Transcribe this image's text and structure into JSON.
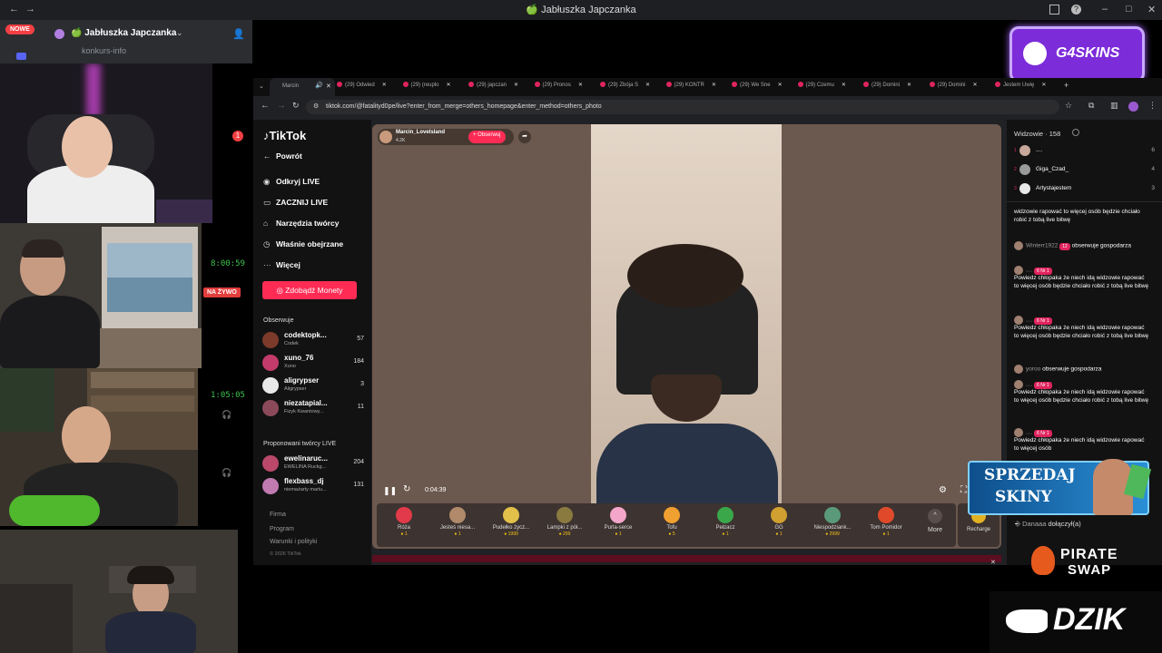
{
  "window": {
    "title": "🍏 Jabłuszka Japczanka"
  },
  "discord": {
    "nowe_badge": "NOWE",
    "server_name": "🍏 Jabłuszka Japczanka",
    "channel": "konkurs-info",
    "mention_count": "1",
    "timer1": "8:00:59",
    "live_badge": "NA ŻYWO",
    "timer2": "1:05:05"
  },
  "browser": {
    "active_tab": "Marcin",
    "tabs": [
      "(29) Odwied",
      "(29) (reuplo",
      "(29) japczan",
      "(29) Pronos",
      "(29) Zbója S",
      "(29) KONTR",
      "(29) We Sne",
      "(29) Czemu",
      "(29) Domini",
      "(29) Domini",
      "Jestem Uwię"
    ],
    "url": "tiktok.com/@fatalityd0pe/live?enter_from_merge=others_homepage&enter_method=others_photo"
  },
  "tiktok": {
    "logo": "TikTok",
    "back": "Powrót",
    "nav": [
      "Odkryj LIVE",
      "ZACZNIJ LIVE",
      "Narzędzia twórcy",
      "Właśnie obejrzane",
      "Więcej"
    ],
    "coins_button": "Zdobądź Monety",
    "following_header": "Obserwuje",
    "following": [
      {
        "name": "codektopk...",
        "sub": "Codek",
        "count": "57"
      },
      {
        "name": "xuno_76",
        "sub": "Xuno",
        "count": "184"
      },
      {
        "name": "aligrypser",
        "sub": "Aligrypser",
        "count": "3"
      },
      {
        "name": "niezatapial...",
        "sub": "Fizyk Kwantowy...",
        "count": "11"
      }
    ],
    "suggested_header": "Proponowani twórcy LIVE",
    "suggested": [
      {
        "name": "ewelinaruc...",
        "sub": "EWELINA Ruckg...",
        "count": "204"
      },
      {
        "name": "flexbass_dj",
        "sub": "niemażarty mariu...",
        "count": "131"
      }
    ],
    "footer": [
      "Firma",
      "Program",
      "Warunki i polityki",
      "© 2026 TikTok"
    ]
  },
  "stream": {
    "host": "Marcin_Lovelsland",
    "likes": "4.2K",
    "follow_button": "+ Obserwuj",
    "time": "0:04:39",
    "gifts": [
      {
        "name": "Róża",
        "price": "1"
      },
      {
        "name": "Jesteś niesa...",
        "price": "1"
      },
      {
        "name": "Pudełko życz...",
        "price": "1999"
      },
      {
        "name": "Lampki z pół...",
        "price": "299"
      },
      {
        "name": "Purla-serce",
        "price": "1"
      },
      {
        "name": "Tofu",
        "price": "5"
      },
      {
        "name": "Pełzacz",
        "price": "1"
      },
      {
        "name": "GG",
        "price": "1"
      },
      {
        "name": "Niespodziank...",
        "price": "2999"
      },
      {
        "name": "Tom Pomidor",
        "price": "1"
      }
    ],
    "more": "More",
    "recharge": "Recharge"
  },
  "viewers_panel": {
    "title": "Widzowie · 158",
    "top": [
      {
        "rank": "1",
        "name": "....",
        "score": "6"
      },
      {
        "rank": "2",
        "name": "Giga_Czad_",
        "score": "4"
      },
      {
        "rank": "3",
        "name": "Artystajestem",
        "score": "3"
      }
    ],
    "comments": [
      {
        "user": "",
        "badge": "",
        "text": "widzowie rapować to więcej osób będzie chciało robić z tobą live bitwę"
      },
      {
        "user": "Winterr1922",
        "badge": "12",
        "text": "obserwuje gospodarza"
      },
      {
        "user": "....",
        "badge": "6 Nr 1",
        "text": "Powiedz chłopaka że niech idą widzowie rapować to więcej osób będzie chciało robić z tobą live bitwę"
      },
      {
        "user": "....",
        "badge": "6 Nr 1",
        "text": "Powiedz chłopaka że niech idą widzowie rapować to więcej osób będzie chciało robić z tobą live bitwę"
      },
      {
        "user": "yoroo",
        "badge": "",
        "text": "obserwuje gospodarza"
      },
      {
        "user": "....",
        "badge": "6 Nr 1",
        "text": "Powiedz chłopaka że niech idą widzowie rapować to więcej osób będzie chciało robić z tobą live bitwę"
      },
      {
        "user": "....",
        "badge": "6 Nr 1",
        "text": "Powiedz chłopaka że niech idą widzowie rapować to więcej osób"
      }
    ],
    "join_user": "Danaaa",
    "join_text": "dołączył(a)"
  },
  "ads": {
    "g4skins": "G4SKINS",
    "sell_line1": "SPRZEDAJ",
    "sell_line2": "SKINY",
    "pirate1": "PIRATE",
    "pirate2": "SWAP",
    "dzik": "DZIK"
  },
  "colors": {
    "accent": "#fe2c55",
    "discord_bg": "#2b2d31",
    "tiktok_bg": "#121212",
    "green": "#3ec24f"
  }
}
